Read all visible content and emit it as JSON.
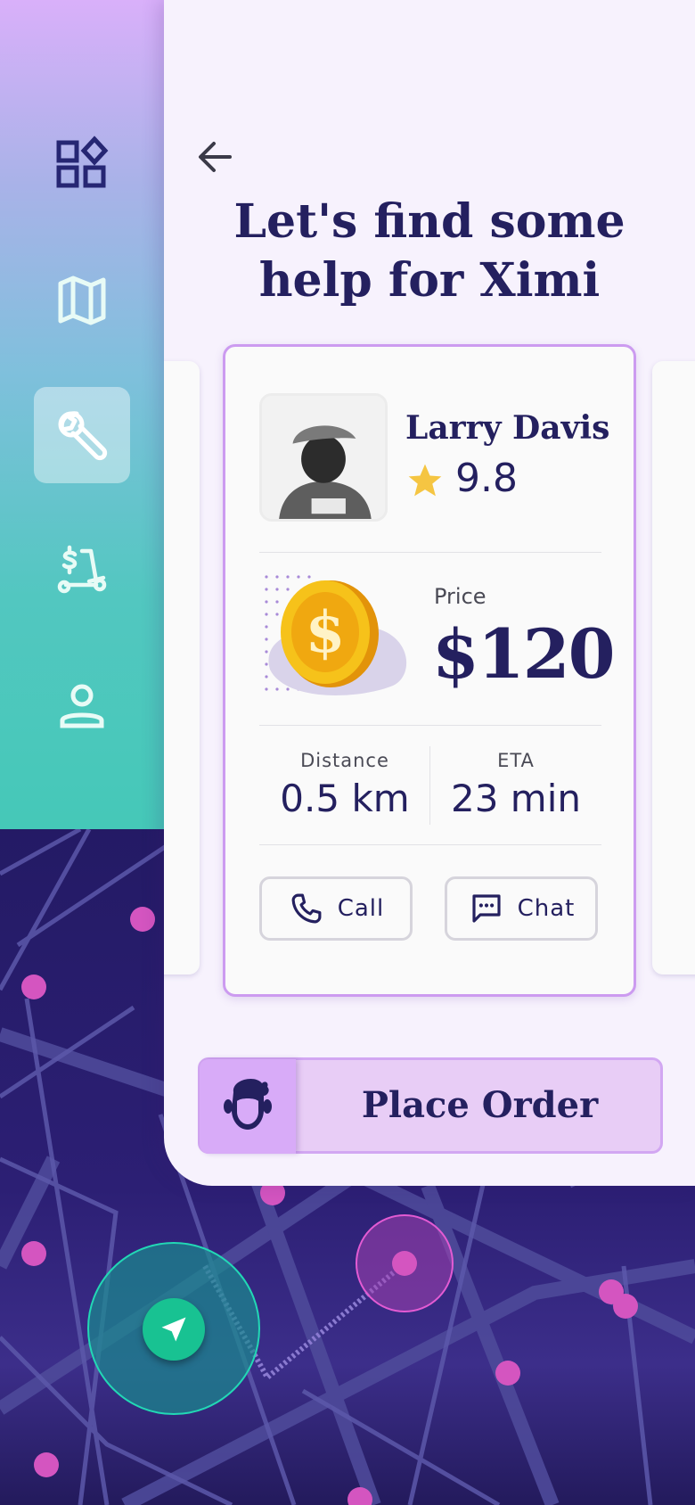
{
  "sidebar": {
    "items": [
      {
        "id": "dashboard",
        "icon": "dashboard-icon",
        "active": false
      },
      {
        "id": "map",
        "icon": "map-icon",
        "active": false
      },
      {
        "id": "services",
        "icon": "wrench-icon",
        "active": true
      },
      {
        "id": "pricing",
        "icon": "scooter-price-icon",
        "active": false
      },
      {
        "id": "profile",
        "icon": "profile-icon",
        "active": false
      }
    ],
    "icon_color_dark": "#262673",
    "icon_color_light": "#e8fbf6"
  },
  "header": {
    "back_icon": "back-arrow-icon",
    "title_line1": "Let's find some",
    "title_line2": "help for Ximi"
  },
  "helper_card": {
    "name": "Larry Davis",
    "rating": "9.8",
    "rating_icon": "star-icon",
    "price_label": "Price",
    "price": "$120",
    "distance_label": "Distance",
    "distance": "0.5 km",
    "eta_label": "ETA",
    "eta": "23 min",
    "call_label": "Call",
    "chat_label": "Chat"
  },
  "order": {
    "label": "Place Order",
    "icon": "person-head-icon"
  },
  "map": {
    "locate_icon": "navigation-arrow-icon"
  },
  "colors": {
    "primary_text": "#24205f",
    "accent_purple": "#cc9bf0",
    "map_dot": "#d455c0",
    "teal": "#18c292",
    "star": "#f5c542"
  }
}
